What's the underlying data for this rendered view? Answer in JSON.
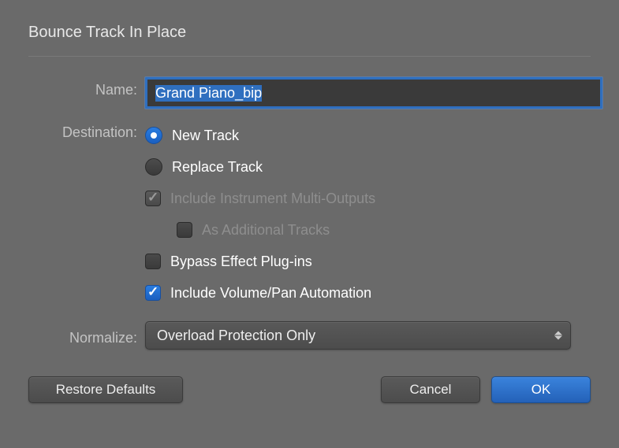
{
  "dialog": {
    "title": "Bounce Track In Place",
    "name_label": "Name:",
    "name_value": "Grand Piano_bip",
    "destination_label": "Destination:",
    "radio_new_track": "New Track",
    "radio_replace_track": "Replace Track",
    "destination_selected": "new",
    "check_include_multi": "Include Instrument Multi-Outputs",
    "check_include_multi_checked": true,
    "check_include_multi_enabled": false,
    "check_as_additional": "As Additional Tracks",
    "check_as_additional_checked": false,
    "check_as_additional_enabled": false,
    "check_bypass": "Bypass Effect Plug-ins",
    "check_bypass_checked": false,
    "check_include_vol": "Include Volume/Pan Automation",
    "check_include_vol_checked": true,
    "normalize_label": "Normalize:",
    "normalize_value": "Overload Protection Only",
    "btn_restore": "Restore Defaults",
    "btn_cancel": "Cancel",
    "btn_ok": "OK"
  }
}
